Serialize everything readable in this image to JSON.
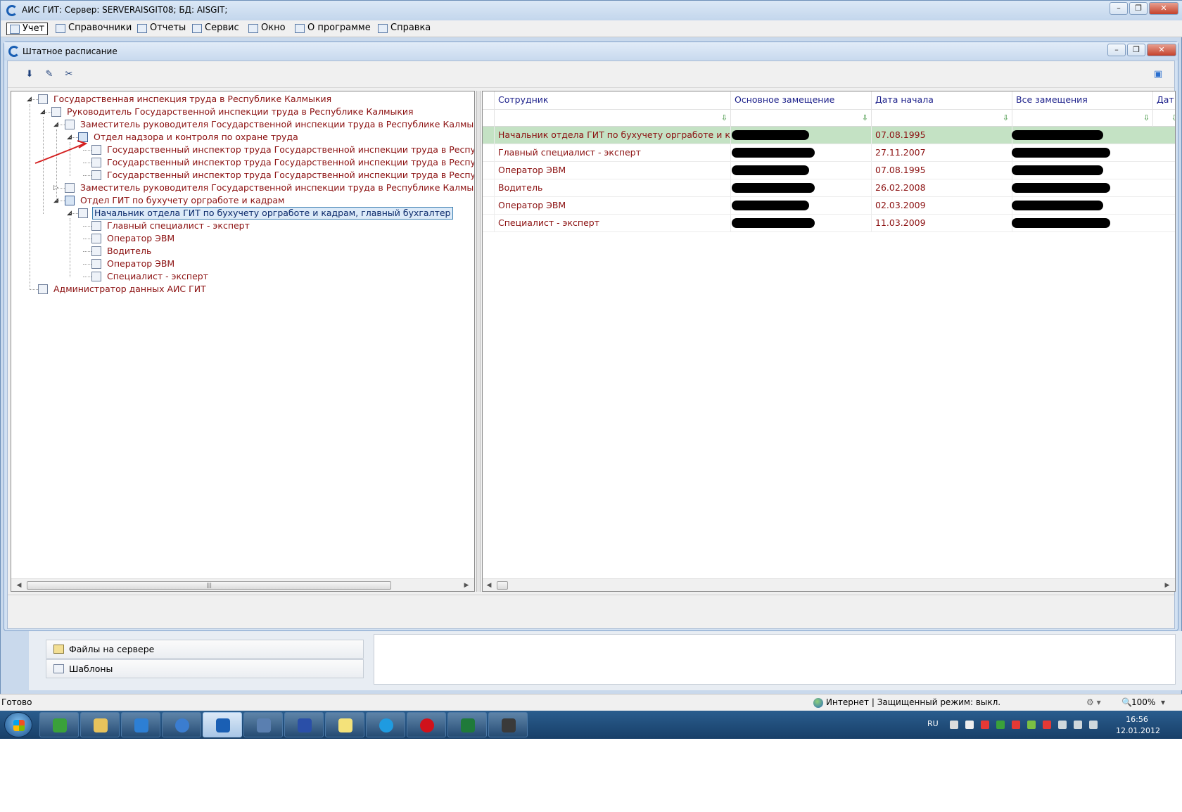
{
  "window": {
    "title": "АИС ГИТ:  Сервер: SERVERAISGIT08;   БД: AISGIT;"
  },
  "menu": [
    {
      "label": "Учет",
      "icon": "grid-icon"
    },
    {
      "label": "Справочники",
      "icon": "book-icon"
    },
    {
      "label": "Отчеты",
      "icon": "table-icon"
    },
    {
      "label": "Сервис",
      "icon": "home-icon"
    },
    {
      "label": "Окно",
      "icon": "windows-icon"
    },
    {
      "label": "О программе",
      "icon": "smiley-icon"
    },
    {
      "label": "Справка",
      "icon": "help-book-icon"
    }
  ],
  "inner_window": {
    "title": "Штатное расписание"
  },
  "toolbar": {
    "buttons": [
      "save-icon",
      "edit-icon",
      "scissors-icon"
    ]
  },
  "tree": {
    "nodes": [
      {
        "label": "Государственная инспекция труда в Республике Калмыкия",
        "level": 0,
        "expander": "◢",
        "icon": "org-icon"
      },
      {
        "label": "Руководитель Государственной инспекции труда в Республике Калмыкия",
        "level": 1,
        "expander": "◢",
        "icon": "person-icon"
      },
      {
        "label": "Заместитель руководителя Государственной инспекции труда в Республике Калмыкия (по охране труда)",
        "level": 2,
        "expander": "◢",
        "icon": "person-icon"
      },
      {
        "label": "Отдел надзора и контроля по охране труда",
        "level": 3,
        "expander": "◢",
        "icon": "folder-icon"
      },
      {
        "label": "Государственный инспектор труда Государственной инспекции труда в Республике Калмыкия",
        "level": 4,
        "expander": "",
        "icon": "document-icon"
      },
      {
        "label": "Государственный инспектор труда Государственной инспекции труда в Республике Калмыкия",
        "level": 4,
        "expander": "",
        "icon": "document-icon"
      },
      {
        "label": "Государственный инспектор труда Государственной инспекции труда в Республике Калмыкия",
        "level": 4,
        "expander": "",
        "icon": "document-icon"
      },
      {
        "label": "Заместитель руководителя Государственной инспекции труда в Республике Калмыкия (по правовым вопросам)",
        "level": 2,
        "expander": "▷",
        "icon": "person-icon"
      },
      {
        "label": "Отдел ГИТ по бухучету оргработе и кадрам",
        "level": 2,
        "expander": "◢",
        "icon": "folder-icon"
      },
      {
        "label": "Начальник отдела ГИТ по  бухучету оргработе и кадрам, главный бухгалтер",
        "level": 3,
        "expander": "◢",
        "icon": "document-icon",
        "selected": true
      },
      {
        "label": "Главный специалист - эксперт",
        "level": 4,
        "expander": "",
        "icon": "document-icon"
      },
      {
        "label": "Оператор ЭВМ",
        "level": 4,
        "expander": "",
        "icon": "document-icon"
      },
      {
        "label": "Водитель",
        "level": 4,
        "expander": "",
        "icon": "document-icon"
      },
      {
        "label": "Оператор ЭВМ",
        "level": 4,
        "expander": "",
        "icon": "document-icon"
      },
      {
        "label": "Специалист - эксперт",
        "level": 4,
        "expander": "",
        "icon": "document-icon"
      },
      {
        "label": "Администратор данных АИС ГИТ",
        "level": 0,
        "expander": "",
        "icon": "document-icon"
      }
    ]
  },
  "grid": {
    "columns": [
      "Сотрудник",
      "Основное замещение",
      "Дата начала",
      "Все замещения",
      "Дат"
    ],
    "rows": [
      {
        "employee": "Начальник отдела ГИТ по  бухучету оргработе и кадра",
        "main": "",
        "start": "07.08.1995",
        "all": "",
        "selected": true
      },
      {
        "employee": "Главный специалист - эксперт",
        "main": "",
        "start": "27.11.2007",
        "all": ""
      },
      {
        "employee": "Оператор ЭВМ",
        "main": "",
        "start": "07.08.1995",
        "all": ""
      },
      {
        "employee": "Водитель",
        "main": "",
        "start": "26.02.2008",
        "all": ""
      },
      {
        "employee": "Оператор ЭВМ",
        "main": "",
        "start": "02.03.2009",
        "all": ""
      },
      {
        "employee": "Специалист - эксперт",
        "main": "",
        "start": "11.03.2009",
        "all": ""
      }
    ]
  },
  "side_panel": {
    "items": [
      "Файлы на сервере",
      "Шаблоны"
    ]
  },
  "statusbar": {
    "left": "Готово",
    "zone": "Интернет | Защищенный режим: выкл.",
    "zoom": "100%"
  },
  "taskbar": {
    "lang": "RU",
    "time": "16:56",
    "date": "12.01.2012"
  },
  "colors": {
    "accent": "#1b1f8a",
    "row_text": "#8b1010",
    "selected_row": "#c4e2c4"
  }
}
